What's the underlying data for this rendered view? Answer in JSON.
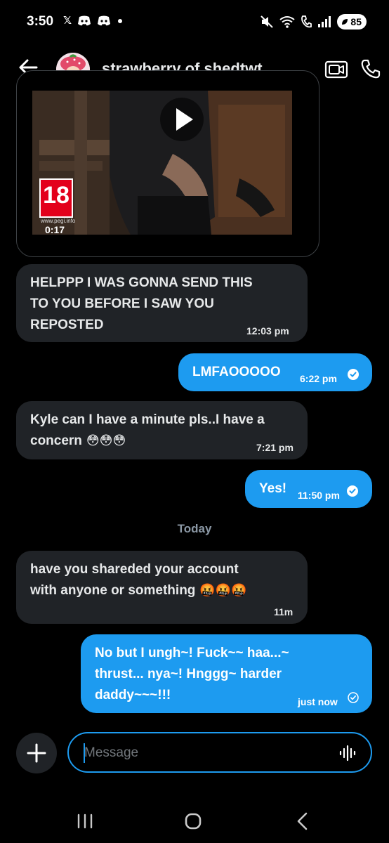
{
  "status_bar": {
    "time": "3:50",
    "left_icons": [
      "x-icon",
      "discord-icon",
      "discord-icon",
      "dot-icon"
    ],
    "battery": "85"
  },
  "header": {
    "contact_name": "strawberry of shedtwt"
  },
  "media": {
    "rating": "18",
    "rating_site": "www.pegi.info",
    "duration": "0:17"
  },
  "messages": [
    {
      "direction": "in",
      "lines": [
        "HELPPP I WAS GONNA SEND THIS",
        "TO YOU BEFORE I SAW YOU",
        "REPOSTED"
      ],
      "time": "12:03 pm"
    },
    {
      "direction": "out",
      "lines": [
        "LMFAOOOOO"
      ],
      "time": "6:22 pm",
      "status": "seen"
    },
    {
      "direction": "in",
      "lines": [
        "Kyle can I have a minute pls..I have a",
        "concern"
      ],
      "emoji": "😳😳😳",
      "time": "7:21 pm"
    },
    {
      "direction": "out",
      "lines": [
        "Yes!"
      ],
      "time": "11:50 pm",
      "status": "seen"
    },
    {
      "direction": "in",
      "lines": [
        "have you shareded your account",
        "with anyone or something"
      ],
      "emoji": "🤬🤬🤬",
      "time": "11m"
    },
    {
      "direction": "out",
      "lines": [
        "No but I ungh~! Fuck~~ haa...~",
        "thrust... nya~! Hnggg~ harder",
        "daddy~~~!!!"
      ],
      "time": "just now",
      "status": "sent"
    }
  ],
  "day_divider": "Today",
  "composer": {
    "placeholder": "Message"
  },
  "colors": {
    "accent": "#1d9bf0",
    "incoming_bubble": "#202327",
    "background": "#000000"
  }
}
